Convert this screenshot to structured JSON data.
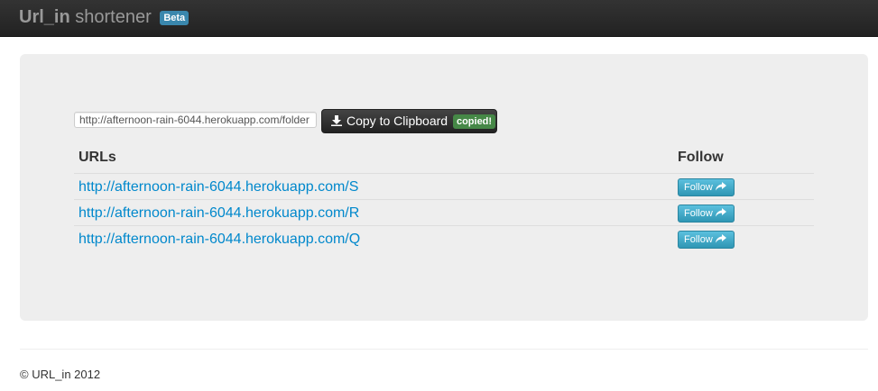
{
  "navbar": {
    "brand_strong": "Url_in",
    "brand_rest": "shortener",
    "badge": "Beta"
  },
  "hero": {
    "url_input_value": "http://afternoon-rain-6044.herokuapp.com/folder",
    "copy_button_label": "Copy to Clipboard",
    "copied_badge": "copied!",
    "copy_icon": "download-icon"
  },
  "table": {
    "header_urls": "URLs",
    "header_follow": "Follow",
    "rows": [
      {
        "url": "http://afternoon-rain-6044.herokuapp.com/S",
        "follow_label": "Follow"
      },
      {
        "url": "http://afternoon-rain-6044.herokuapp.com/R",
        "follow_label": "Follow"
      },
      {
        "url": "http://afternoon-rain-6044.herokuapp.com/Q",
        "follow_label": "Follow"
      }
    ],
    "follow_icon": "share-arrow-icon"
  },
  "footer": {
    "text": "© URL_in 2012"
  },
  "colors": {
    "navbar_bg": "#222222",
    "hero_bg": "#eeeeee",
    "link": "#0088cc",
    "info_button": "#2f96b4",
    "beta_badge": "#3a87ad",
    "copied_badge": "#468847"
  }
}
